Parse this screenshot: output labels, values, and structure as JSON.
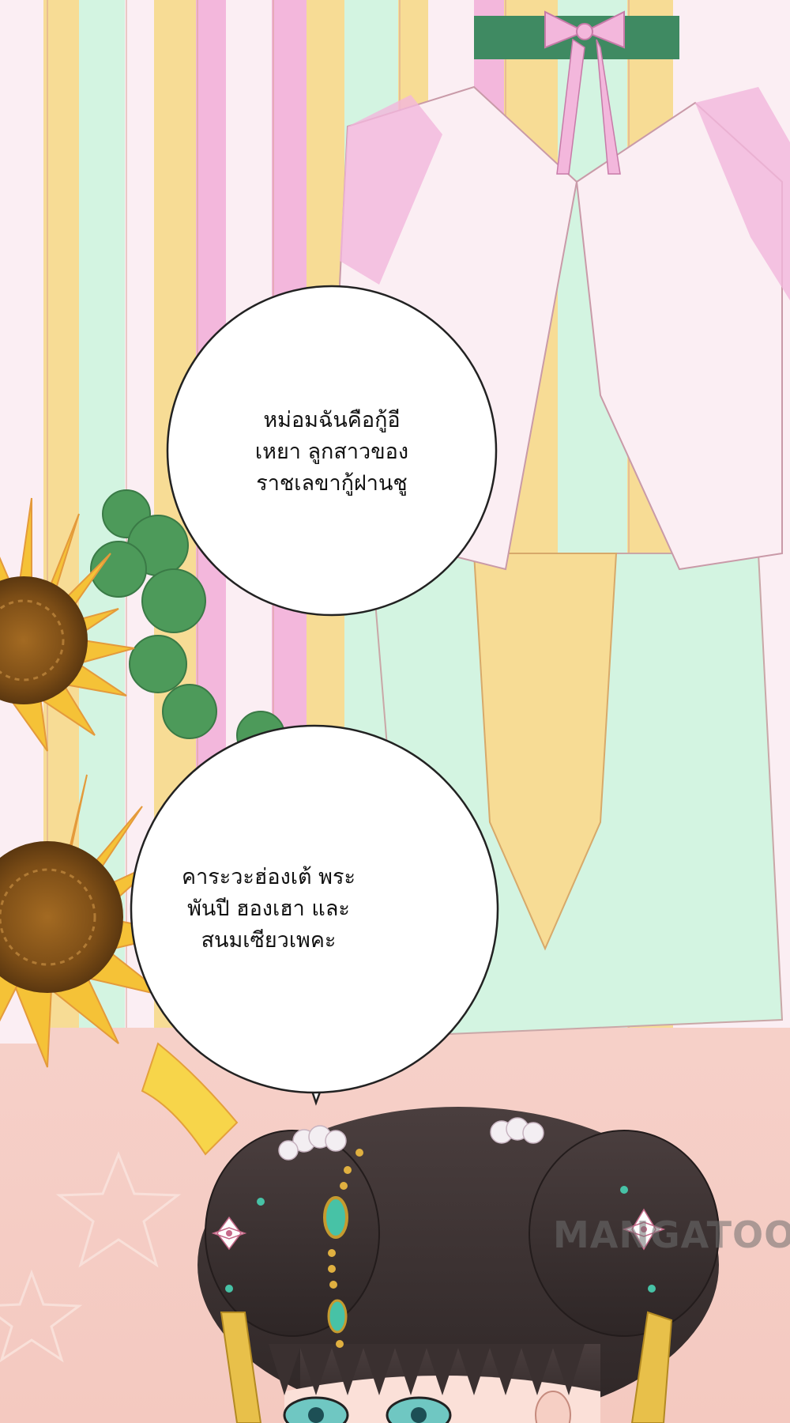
{
  "panel": {
    "description_colors": {
      "background_pink": "#f6d3cc",
      "robe_white": "#fbeef3",
      "robe_pink": "#f3b7dc",
      "robe_yellow": "#f7dc95",
      "robe_mint": "#d3f4e1",
      "sash_green": "#3f8a62",
      "sunflower_yellow": "#f5c237",
      "sunflower_center": "#8a5a1c",
      "hair_dark": "#3c3232"
    }
  },
  "bubbles": [
    {
      "lines": [
        "หม่อมฉันคือกู้อี",
        "เหยา ลูกสาวของ",
        "ราชเลขากู้ฝานชู"
      ]
    },
    {
      "lines": [
        "คาระวะฮ่องเต้ พระ",
        "พันปี ฮองเฮา และ",
        "สนมเซียวเพคะ"
      ]
    }
  ],
  "watermark": {
    "text": "MANGATOON"
  }
}
